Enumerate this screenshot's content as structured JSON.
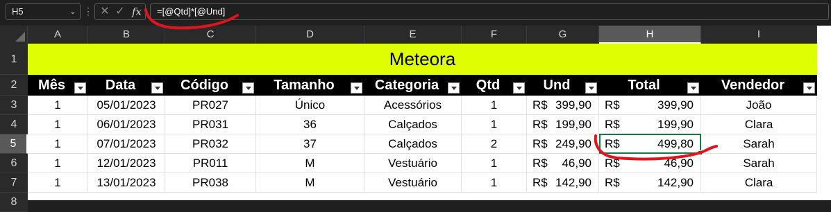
{
  "formula_bar": {
    "name_box": "H5",
    "formula": "=[@Qtd]*[@Und]"
  },
  "columns": [
    "A",
    "B",
    "C",
    "D",
    "E",
    "F",
    "G",
    "H",
    "I"
  ],
  "rows": [
    "1",
    "2",
    "3",
    "4",
    "5",
    "6",
    "7",
    "8"
  ],
  "sheet": {
    "title": "Meteora",
    "headers": [
      "Mês",
      "Data",
      "Código",
      "Tamanho",
      "Categoria",
      "Qtd",
      "Und",
      "Total",
      "Vendedor"
    ],
    "records": [
      {
        "mes": "1",
        "data": "05/01/2023",
        "codigo": "PR027",
        "tamanho": "Único",
        "categoria": "Acessórios",
        "qtd": "1",
        "und_cur": "R$",
        "und": "399,90",
        "total_cur": "R$",
        "total": "399,90",
        "vendedor": "João"
      },
      {
        "mes": "1",
        "data": "06/01/2023",
        "codigo": "PR031",
        "tamanho": "36",
        "categoria": "Calçados",
        "qtd": "1",
        "und_cur": "R$",
        "und": "199,90",
        "total_cur": "R$",
        "total": "199,90",
        "vendedor": "Clara"
      },
      {
        "mes": "1",
        "data": "07/01/2023",
        "codigo": "PR032",
        "tamanho": "37",
        "categoria": "Calçados",
        "qtd": "2",
        "und_cur": "R$",
        "und": "249,90",
        "total_cur": "R$",
        "total": "499,80",
        "vendedor": "Sarah"
      },
      {
        "mes": "1",
        "data": "12/01/2023",
        "codigo": "PR011",
        "tamanho": "M",
        "categoria": "Vestuário",
        "qtd": "1",
        "und_cur": "R$",
        "und": "46,90",
        "total_cur": "R$",
        "total": "46,90",
        "vendedor": "Sarah"
      },
      {
        "mes": "1",
        "data": "13/01/2023",
        "codigo": "PR038",
        "tamanho": "M",
        "categoria": "Vestuário",
        "qtd": "1",
        "und_cur": "R$",
        "und": "142,90",
        "total_cur": "R$",
        "total": "142,90",
        "vendedor": "Clara"
      }
    ]
  },
  "colors": {
    "title_fill": "#dfff00",
    "header_fill": "#000000",
    "selection": "#107c41",
    "annotation": "#e0141e"
  }
}
